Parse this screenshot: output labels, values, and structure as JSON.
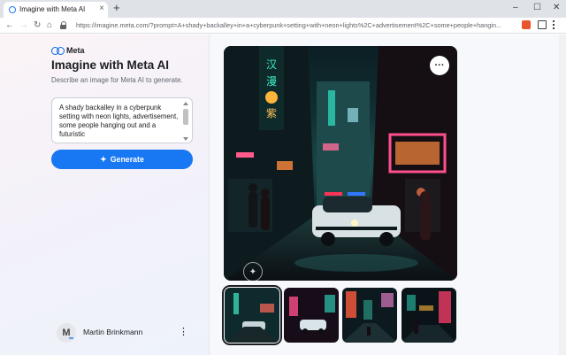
{
  "browser": {
    "tab_title": "Imagine with Meta AI",
    "tab_close": "×",
    "new_tab": "+",
    "url": "https://imagine.meta.com/?prompt=A+shady+backalley+in+a+cyberpunk+setting+with+neon+lights%2C+advertisement%2C+some+people+hangin...",
    "minimize": "–",
    "maximize": "☐",
    "close": "✕",
    "back": "←",
    "forward": "→",
    "reload": "↻",
    "bookmark": "⌂"
  },
  "sidebar": {
    "brand": "Meta",
    "title": "Imagine with Meta AI",
    "subtitle": "Describe an image for Meta AI to generate.",
    "prompt": "A shady backalley in a cyberpunk setting with neon lights, advertisement, some people hanging out and a futuristic",
    "generate_label": "Generate",
    "generate_icon": "sparkle-icon",
    "user": {
      "initial": "M",
      "name": "Martin Brinkmann",
      "menu": "⋮"
    }
  },
  "image_panel": {
    "more_label": "···",
    "watermark": "✦",
    "thumbnail_count": 4
  },
  "colors": {
    "accent": "#1877f2",
    "neon_pink": "#ff4f8b",
    "neon_teal": "#2ee6c8",
    "neon_orange": "#ff8a3d"
  }
}
